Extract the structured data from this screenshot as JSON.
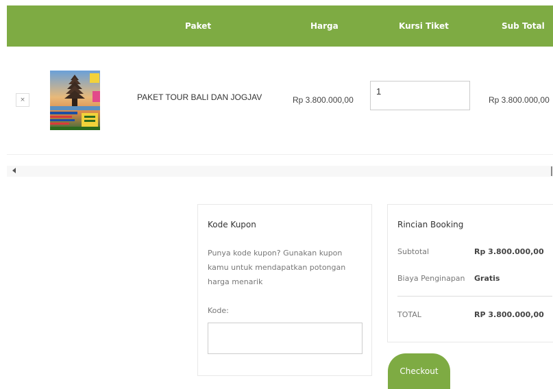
{
  "table": {
    "headers": {
      "paket": "Paket",
      "harga": "Harga",
      "kursi": "Kursi Tiket",
      "subtotal": "Sub Total"
    },
    "row": {
      "remove": "×",
      "name": "PAKET TOUR BALI DAN JOGJAV",
      "price": "Rp 3.800.000,00",
      "quantity": "1",
      "subtotal": "Rp 3.800.000,00"
    }
  },
  "coupon": {
    "title": "Kode Kupon",
    "description": "Punya kode kupon? Gunakan kupon kamu untuk mendapatkan potongan harga menarik",
    "code_label": "Kode:",
    "code_value": ""
  },
  "booking": {
    "title": "Rincian Booking",
    "subtotal_label": "Subtotal",
    "subtotal_value": "Rp 3.800.000,00",
    "lodging_label": "Biaya Penginapan",
    "lodging_value": "Gratis",
    "total_label": "TOTAL",
    "total_value": "RP 3.800.000,00"
  },
  "checkout_label": "Checkout",
  "colors": {
    "accent": "#7eab43"
  }
}
